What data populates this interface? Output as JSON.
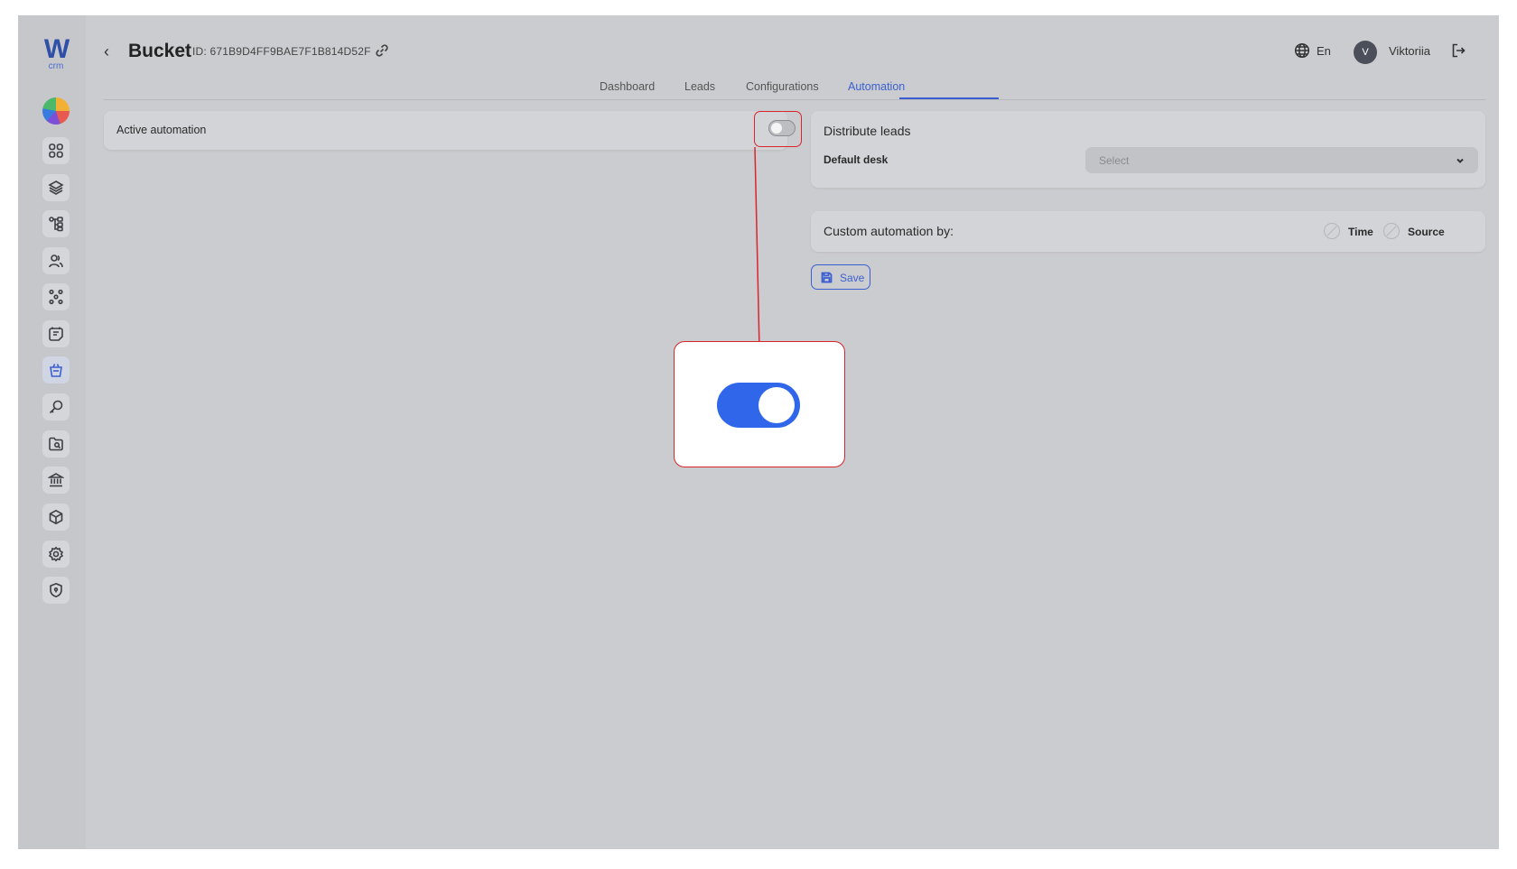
{
  "header": {
    "back_glyph": "‹",
    "title": "Bucket",
    "id_text": "ID: 671B9D4FF9BAE7F1B814D52F",
    "language": "En",
    "avatar_initial": "V",
    "username": "Viktoriia"
  },
  "logo": {
    "mark": "W",
    "sub": "crm"
  },
  "tabs": [
    {
      "label": "Dashboard"
    },
    {
      "label": "Leads"
    },
    {
      "label": "Configurations"
    },
    {
      "label": "Automation",
      "active": true
    }
  ],
  "active_automation": {
    "label": "Active automation",
    "enabled": false
  },
  "distribute": {
    "title": "Distribute leads",
    "default_desk_label": "Default desk",
    "select_placeholder": "Select"
  },
  "custom": {
    "title": "Custom automation by:",
    "options": [
      {
        "label": "Time"
      },
      {
        "label": "Source"
      }
    ]
  },
  "save": {
    "label": "Save"
  },
  "annotation": {
    "zoomed_toggle_enabled": true
  },
  "colors": {
    "accent": "#3b5fd1",
    "annotation": "#d7262c",
    "toggle_on": "#2f66ea"
  }
}
